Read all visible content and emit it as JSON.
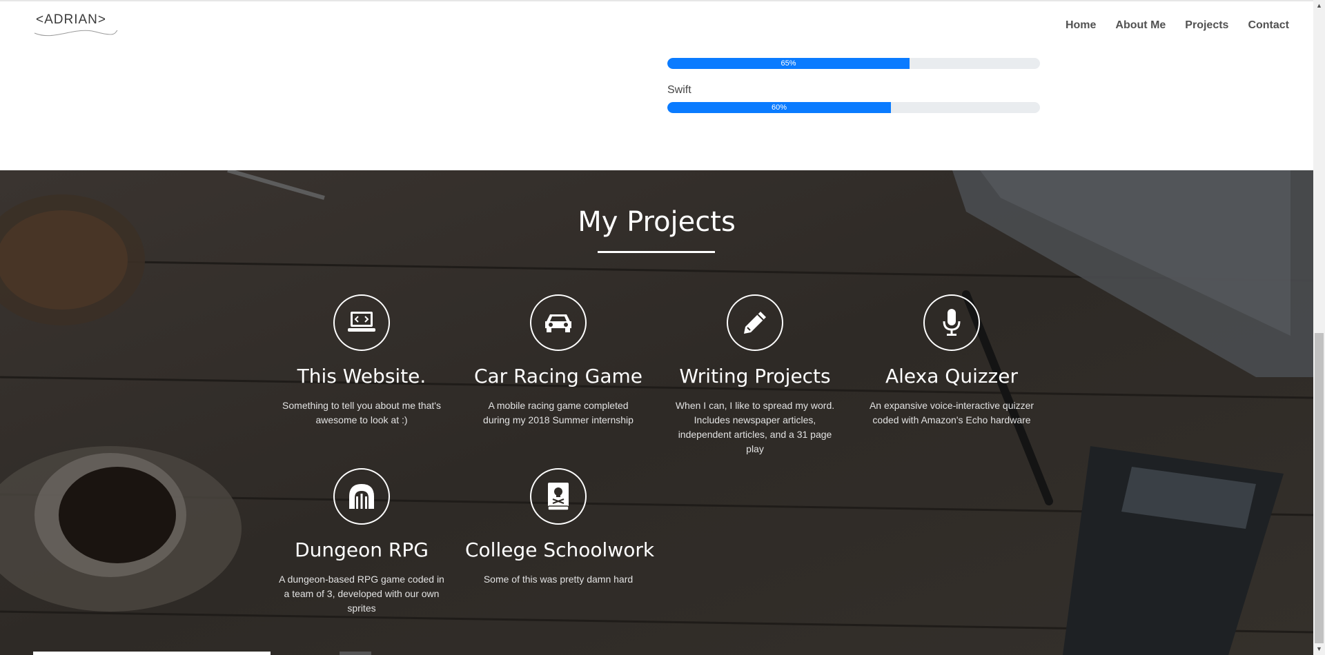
{
  "header": {
    "logo_text": "<ADRIAN>",
    "nav": [
      "Home",
      "About Me",
      "Projects",
      "Contact"
    ]
  },
  "skills": [
    {
      "label": "",
      "percent": 65,
      "percent_label": "65%"
    },
    {
      "label": "Swift",
      "percent": 60,
      "percent_label": "60%"
    }
  ],
  "projects": {
    "title": "My Projects",
    "items": [
      {
        "icon": "laptop-code-icon",
        "title": "This Website.",
        "desc": "Something to tell you about me that's awesome to look at :)"
      },
      {
        "icon": "car-icon",
        "title": "Car Racing Game",
        "desc": "A mobile racing game completed during my 2018 Summer internship"
      },
      {
        "icon": "pencil-icon",
        "title": "Writing Projects",
        "desc": "When I can, I like to spread my word. Includes newspaper articles, independent articles, and a 31 page play"
      },
      {
        "icon": "microphone-icon",
        "title": "Alexa Quizzer",
        "desc": "An expansive voice-interactive quizzer coded with Amazon's Echo hardware"
      },
      {
        "icon": "dungeon-icon",
        "title": "Dungeon RPG",
        "desc": "A dungeon-based RPG game coded in a team of 3, developed with our own sprites"
      },
      {
        "icon": "book-skull-icon",
        "title": "College Schoolwork",
        "desc": "Some of this was pretty damn hard"
      }
    ]
  },
  "colors": {
    "accent": "#0a7bff",
    "section_bg": "#2f2b27"
  }
}
